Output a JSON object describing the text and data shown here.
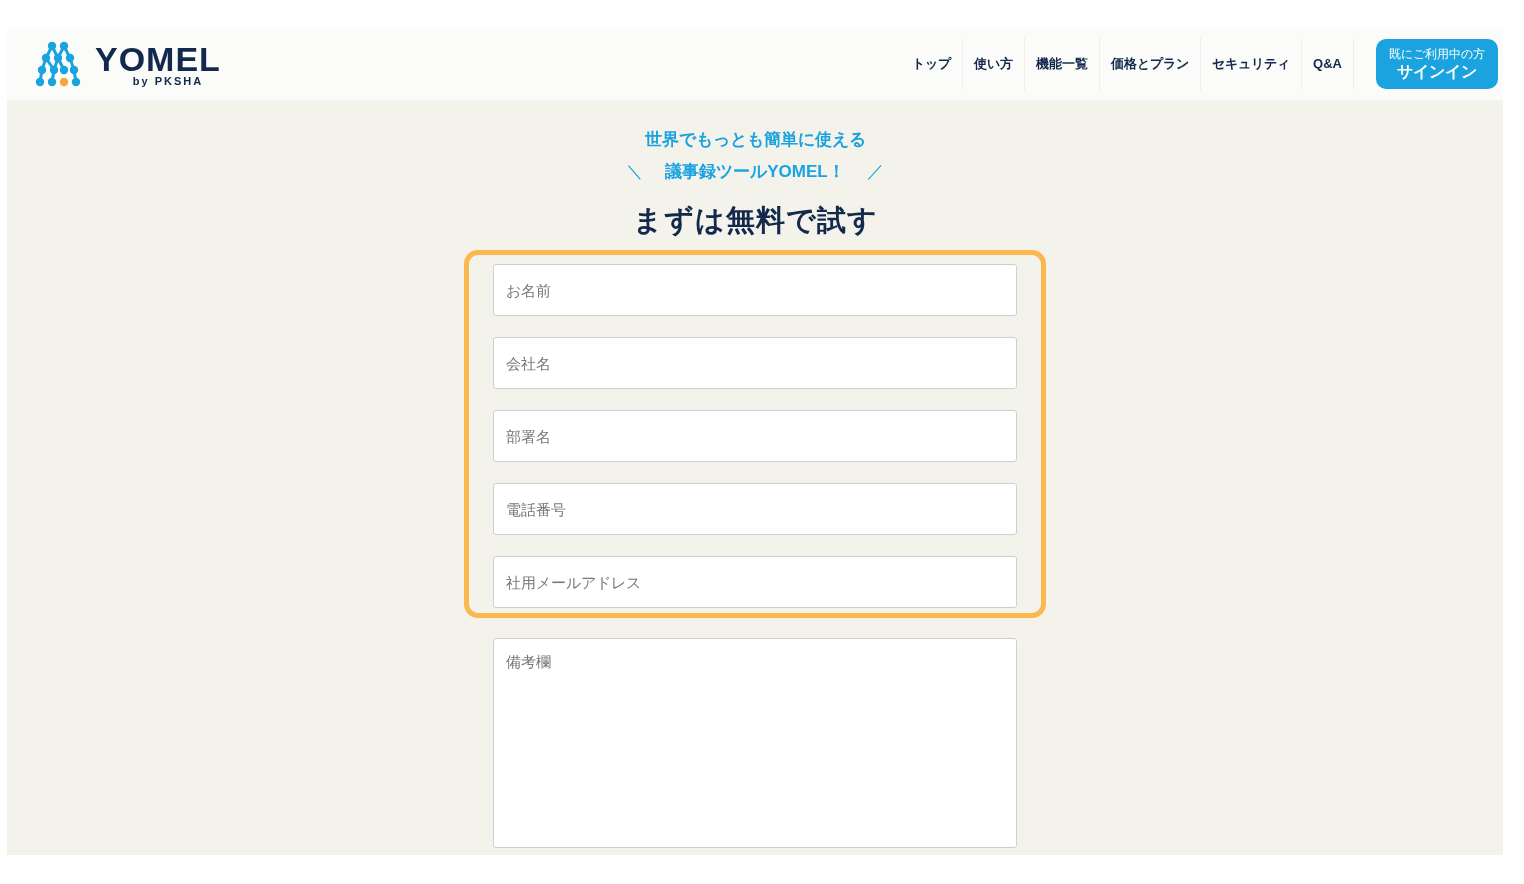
{
  "header": {
    "logo": {
      "name": "YOMEL",
      "byline": "by PKSHA"
    },
    "nav": [
      {
        "label": "トップ"
      },
      {
        "label": "使い方"
      },
      {
        "label": "機能一覧"
      },
      {
        "label": "価格とプラン"
      },
      {
        "label": "セキュリティ"
      },
      {
        "label": "Q&A"
      }
    ],
    "signin": {
      "caption": "既にご利用中の方",
      "label": "サインイン"
    }
  },
  "hero": {
    "tagline_1": "世界でもっとも簡単に使える",
    "tagline_2": "議事録ツールYOMEL！",
    "mark_left": "＼",
    "mark_right": "／",
    "title": "まずは無料で試す"
  },
  "form": {
    "fields": [
      {
        "kind": "input",
        "placeholder": "お名前",
        "highlighted": true
      },
      {
        "kind": "input",
        "placeholder": "会社名",
        "highlighted": true
      },
      {
        "kind": "input",
        "placeholder": "部署名",
        "highlighted": true
      },
      {
        "kind": "input",
        "placeholder": "電話番号",
        "highlighted": true
      },
      {
        "kind": "input",
        "placeholder": "社用メールアドレス",
        "highlighted": true
      },
      {
        "kind": "textarea",
        "placeholder": "備考欄",
        "highlighted": false
      }
    ]
  }
}
